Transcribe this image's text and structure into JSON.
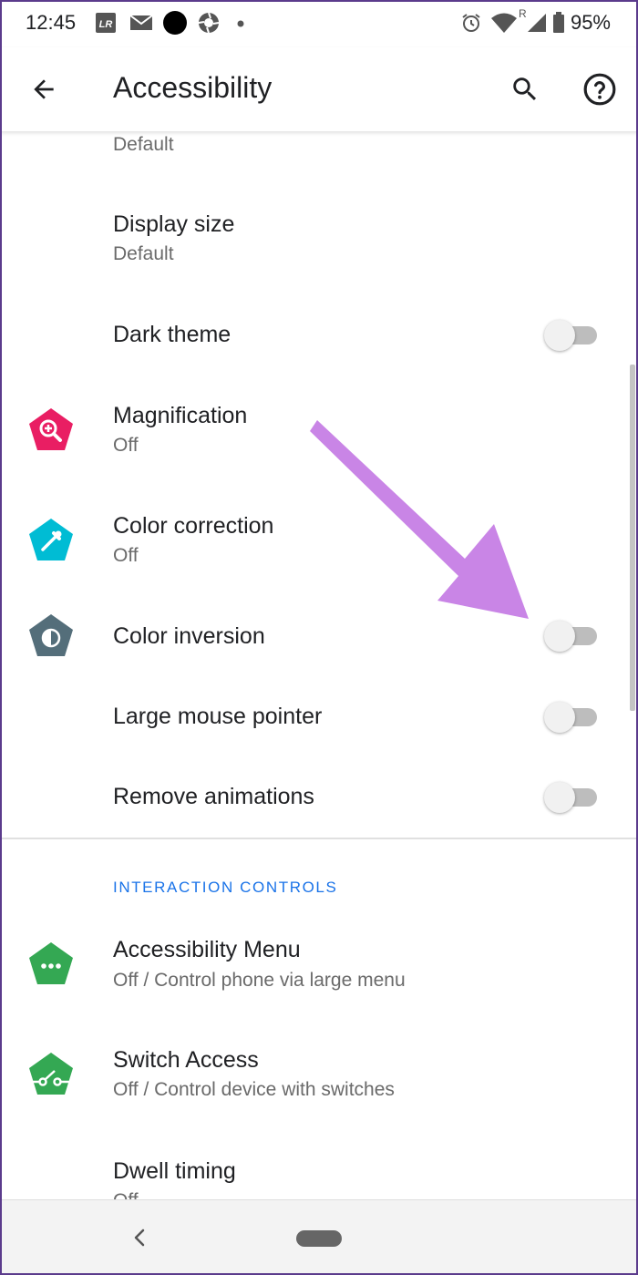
{
  "status_bar": {
    "time": "12:45",
    "left_icons": [
      "lightroom-icon",
      "mail-icon",
      "circle-icon",
      "aperture-icon",
      "dot-icon"
    ],
    "right_icons": [
      "alarm-icon",
      "wifi-icon",
      "signal-icon",
      "battery-icon"
    ],
    "wifi_badge": "R",
    "battery": "95%"
  },
  "app_bar": {
    "title": "Accessibility",
    "back_icon": "arrow-back-icon",
    "search_icon": "search-icon",
    "help_icon": "help-icon"
  },
  "list": {
    "partial_top_subtitle": "Default",
    "display_size": {
      "title": "Display size",
      "subtitle": "Default"
    },
    "dark_theme": {
      "title": "Dark theme",
      "on": false
    },
    "magnification": {
      "title": "Magnification",
      "subtitle": "Off",
      "icon": "magnify-icon",
      "color": "#e91e63"
    },
    "color_correction": {
      "title": "Color correction",
      "subtitle": "Off",
      "icon": "eyedropper-icon",
      "color": "#00bcd4"
    },
    "color_inversion": {
      "title": "Color inversion",
      "on": false,
      "icon": "contrast-icon",
      "color": "#546e7a"
    },
    "large_mouse_pointer": {
      "title": "Large mouse pointer",
      "on": false
    },
    "remove_animations": {
      "title": "Remove animations",
      "on": false
    }
  },
  "interaction_controls": {
    "header": "INTERACTION CONTROLS",
    "accessibility_menu": {
      "title": "Accessibility Menu",
      "subtitle": "Off / Control phone via large menu",
      "icon": "dots-icon",
      "color": "#34a853"
    },
    "switch_access": {
      "title": "Switch Access",
      "subtitle": "Off / Control device with switches",
      "icon": "switch-icon",
      "color": "#34a853"
    },
    "dwell_timing": {
      "title": "Dwell timing",
      "subtitle": "Off"
    }
  },
  "annotation": {
    "arrow_color": "#c985e6",
    "target": "color-inversion-toggle"
  },
  "nav_bar": {
    "back_icon": "nav-back-icon",
    "home_icon": "home-pill-icon"
  }
}
